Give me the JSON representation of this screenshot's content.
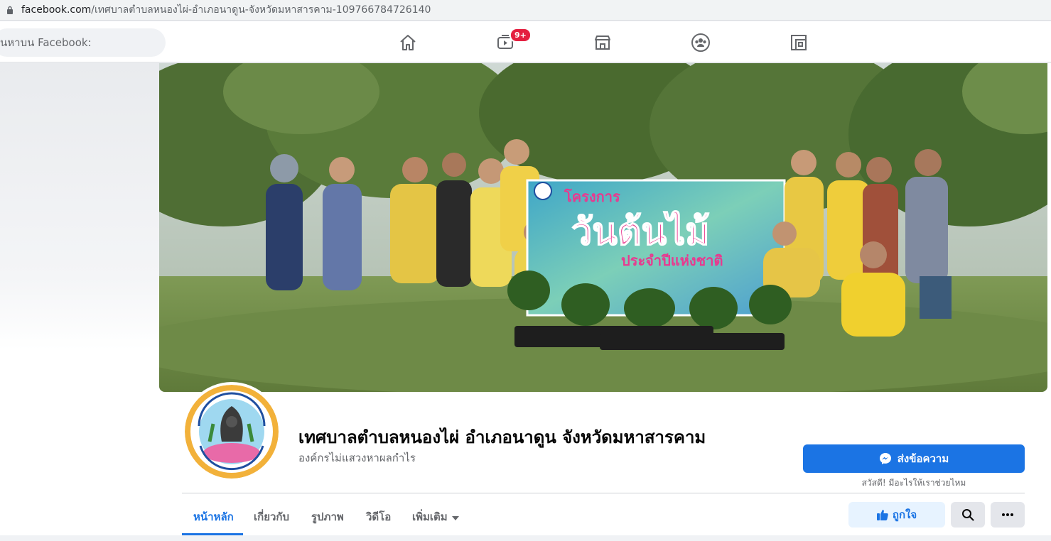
{
  "browser": {
    "url_host": "facebook.com",
    "url_path": "/เทศบาลตำบลหนองไผ่-อำเภอนาดูน-จังหวัดมหาสารคาม-109766784726140"
  },
  "topnav": {
    "search_placeholder": "นหาบน Facebook:",
    "watch_badge": "9+",
    "icons": [
      "home-icon",
      "watch-icon",
      "marketplace-icon",
      "groups-icon",
      "gaming-icon"
    ]
  },
  "page": {
    "title": "เทศบาลตำบลหนองไผ่ อำเภอนาดูน จังหวัดมหาสารคาม",
    "subtitle": "องค์กรไม่แสวงหาผลกำไร",
    "message_button": "ส่งข้อความ",
    "message_hint": "สวัสดี! มีอะไรให้เราช่วยไหม",
    "like_button": "ถูกใจ"
  },
  "tabs": [
    {
      "label": "หน้าหลัก",
      "active": true
    },
    {
      "label": "เกี่ยวกับ",
      "active": false
    },
    {
      "label": "รูปภาพ",
      "active": false
    },
    {
      "label": "วิดีโอ",
      "active": false
    },
    {
      "label": "เพิ่มเติม",
      "active": false
    }
  ],
  "colors": {
    "accent": "#1b74e4",
    "badge": "#e41e3f"
  }
}
